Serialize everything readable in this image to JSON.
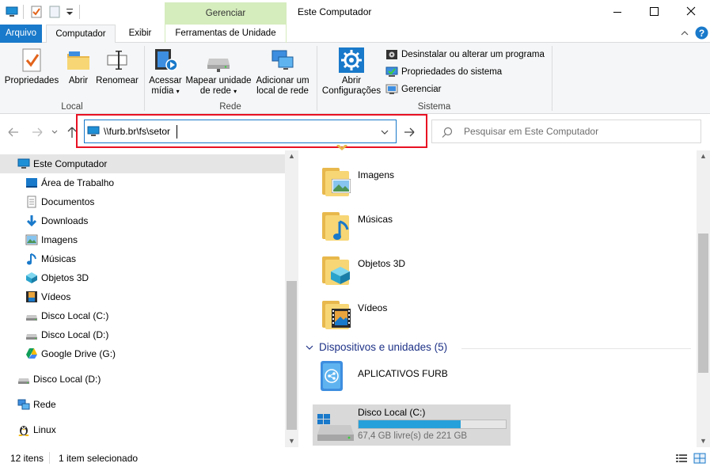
{
  "titlebar": {
    "context_tab": "Gerenciar",
    "window_title": "Este Computador",
    "minimize": "─",
    "maximize": "☐",
    "close": "✕"
  },
  "ribbon_tabs": {
    "file": "Arquivo",
    "computer": "Computador",
    "view": "Exibir",
    "drive_tools": "Ferramentas de Unidade"
  },
  "ribbon": {
    "local": {
      "label": "Local",
      "properties": "Propriedades",
      "open": "Abrir",
      "rename": "Renomear"
    },
    "network": {
      "label": "Rede",
      "access_media_1": "Acessar",
      "access_media_2": "mídia",
      "map_drive_1": "Mapear unidade",
      "map_drive_2": "de rede",
      "add_location_1": "Adicionar um",
      "add_location_2": "local de rede"
    },
    "system": {
      "label": "Sistema",
      "open_settings_1": "Abrir",
      "open_settings_2": "Configurações",
      "uninstall": "Desinstalar ou alterar um programa",
      "system_properties": "Propriedades do sistema",
      "manage": "Gerenciar"
    }
  },
  "navbar": {
    "address_value": "\\\\furb.br\\fs\\setor",
    "search_placeholder": "Pesquisar em Este Computador"
  },
  "nav_pane": {
    "items": [
      {
        "label": "Este Computador",
        "icon": "computer-icon"
      },
      {
        "label": "Área de Trabalho",
        "icon": "desktop-icon"
      },
      {
        "label": "Documentos",
        "icon": "documents-icon"
      },
      {
        "label": "Downloads",
        "icon": "downloads-icon"
      },
      {
        "label": "Imagens",
        "icon": "pictures-icon"
      },
      {
        "label": "Músicas",
        "icon": "music-icon"
      },
      {
        "label": "Objetos 3D",
        "icon": "3d-objects-icon"
      },
      {
        "label": "Vídeos",
        "icon": "videos-icon"
      },
      {
        "label": "Disco Local (C:)",
        "icon": "drive-icon"
      },
      {
        "label": "Disco Local (D:)",
        "icon": "drive-icon"
      },
      {
        "label": "Google Drive (G:)",
        "icon": "google-drive-icon"
      },
      {
        "label": "Disco Local (D:)",
        "icon": "drive-icon"
      },
      {
        "label": "Rede",
        "icon": "network-icon"
      },
      {
        "label": "Linux",
        "icon": "linux-icon"
      }
    ]
  },
  "content": {
    "folders": [
      {
        "label": "Imagens",
        "icon": "pictures-folder-icon"
      },
      {
        "label": "Músicas",
        "icon": "music-folder-icon"
      },
      {
        "label": "Objetos 3D",
        "icon": "3d-objects-folder-icon"
      },
      {
        "label": "Vídeos",
        "icon": "videos-folder-icon"
      }
    ],
    "devices_header": "Dispositivos e unidades (5)",
    "devices": [
      {
        "label": "APLICATIVOS FURB",
        "icon": "app-drive-icon"
      },
      {
        "label": "Disco Local (C:)",
        "free": "67,4 GB livre(s) de 221 GB",
        "used_fraction": 0.695
      }
    ]
  },
  "statusbar": {
    "items_count": "12 itens",
    "selected": "1 item selecionado"
  },
  "colors": {
    "accent_blue": "#1979ca",
    "context_green": "#d5ecbd",
    "highlight_red": "#e81123",
    "drive_bar": "#26a0da"
  }
}
